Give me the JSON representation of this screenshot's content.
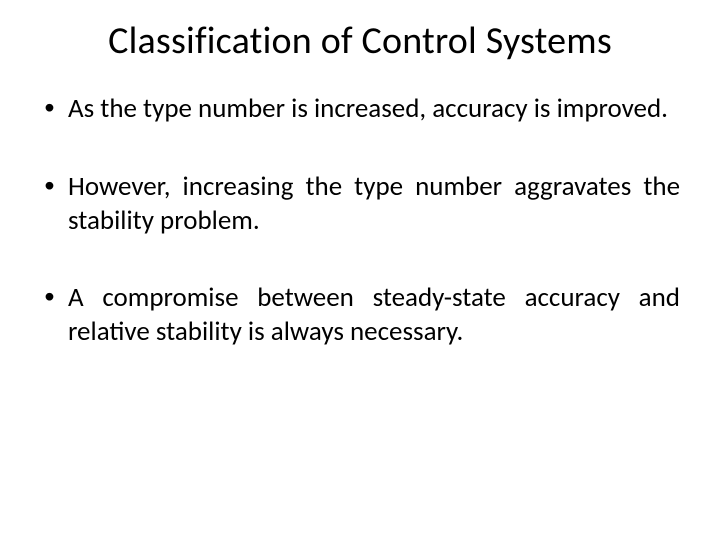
{
  "slide": {
    "title": "Classification of Control Systems",
    "bullets": [
      "As the type number is increased, accuracy is improved.",
      "However, increasing the type number aggravates the stability problem.",
      "A compromise between steady-state accuracy and relative stability is always necessary."
    ]
  }
}
